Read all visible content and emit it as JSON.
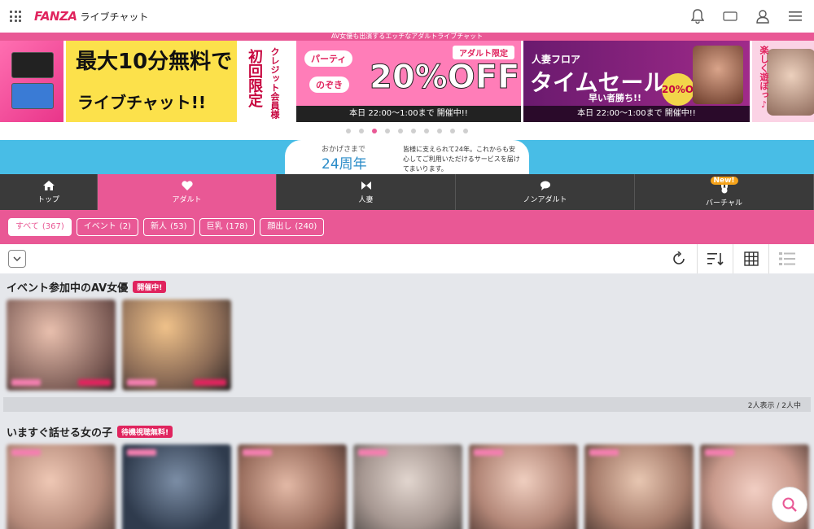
{
  "header": {
    "logo": "FANZA",
    "logo_sub": "ライブチャット",
    "icons": [
      "bell-icon",
      "coupon-icon",
      "user-icon",
      "menu-icon"
    ],
    "coupon_label": "%"
  },
  "banner": {
    "top_text": "AV女優も出演するエッチなアダルトライブチャット",
    "b1_line1": "最大10分無料で",
    "b1_line2": "ライブチャット!!",
    "b1_vertical1": "初回限定",
    "b1_vertical2": "クレジット会員様",
    "b2_tag": "アダルト限定",
    "b2_party": "パーティ",
    "b2_nozoki": "のぞき",
    "b2_big": "20%OFF",
    "b2_time": "本日 22:00～1:00まで 開催中!!",
    "b3_floor": "人妻フロア",
    "b3_big": "タイムセール",
    "b3_sub": "早い者勝ち!!",
    "b3_pct": "20%OFF",
    "b3_time": "本日 22:00～1:00まで 開催中!!",
    "b4_text": "楽しく遊ぼっ♪",
    "dots_total": 10,
    "dots_active": 2
  },
  "anniversary": {
    "line1": "おかげさまで",
    "line2": "24周年",
    "right": "皆様に支えられて24年。これからも安心してご利用いただけるサービスを届けてまいります。"
  },
  "categories": [
    {
      "label": "トップ",
      "icon": "home-icon"
    },
    {
      "label": "アダルト",
      "icon": "heart-icon"
    },
    {
      "label": "人妻",
      "icon": "ribbon-icon"
    },
    {
      "label": "ノンアダルト",
      "icon": "chat-bubble-icon"
    },
    {
      "label": "バーチャル",
      "icon": "bunny-icon",
      "badge": "New!"
    }
  ],
  "filters": [
    {
      "label": "すべて",
      "count": "(367)"
    },
    {
      "label": "イベント",
      "count": "(2)"
    },
    {
      "label": "新人",
      "count": "(53)"
    },
    {
      "label": "巨乳",
      "count": "(178)"
    },
    {
      "label": "顔出し",
      "count": "(240)"
    }
  ],
  "toolbar": {
    "icons": [
      "chevron-down-icon",
      "refresh-icon",
      "sort-icon",
      "grid-view-icon",
      "list-view-icon"
    ]
  },
  "sections": {
    "event": {
      "title": "イベント参加中のAV女優",
      "badge": "開催中!",
      "count": "2人表示 / 2人中"
    },
    "now": {
      "title": "いますぐ話せる女の子",
      "badge": "待機視聴無料!"
    }
  },
  "colors": {
    "accent": "#e95895",
    "brand": "#e0245e"
  }
}
